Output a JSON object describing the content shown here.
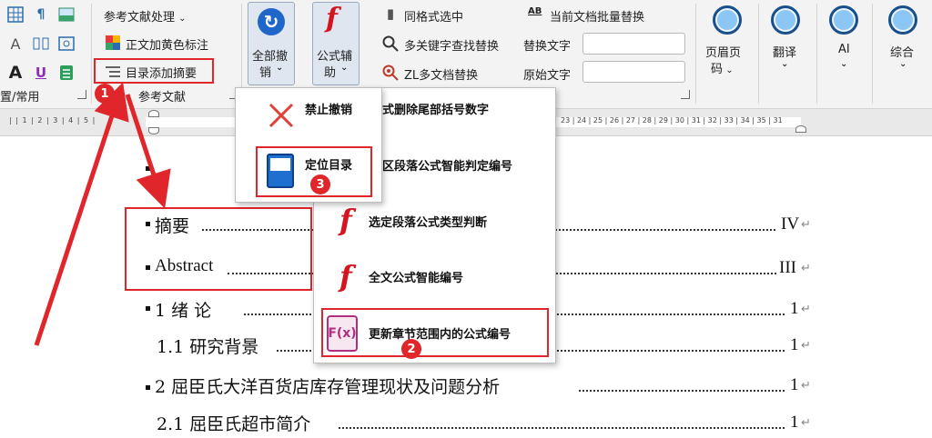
{
  "ribbon": {
    "left_group_label": "置/常用",
    "ref_processing": "参考文献处理",
    "yellow_mark": "正文加黄色标注",
    "toc_add_abstract": "目录添加摘要",
    "group_reference": "参考文献",
    "undo_all_line1": "全部撤",
    "undo_all_line2": "销",
    "formula_line1": "公式辅",
    "formula_line2": "助",
    "same_format": "同格式选中",
    "batch_replace": "当前文档批量替换",
    "multi_keyword": "多关键字查找替换",
    "replace_label": "替换文字",
    "multi_doc": "ZL多文档替换",
    "original_label": "原始文字",
    "header_footer_line1": "页眉页",
    "header_footer_line2": "码",
    "translate": "翻译",
    "ai": "AI",
    "combined": "综合"
  },
  "undo_menu": {
    "forbid_undo": "禁止撤销",
    "locate_toc": "定位目录"
  },
  "formula_menu": {
    "item1": "式删除尾部括号数字",
    "item2": "区段落公式智能判定编号",
    "item3": "选定段落公式类型判断",
    "item4": "全文公式智能编号",
    "item5": "更新章节范围内的公式编号"
  },
  "ruler": {
    "left": "| | 1 | 2 | 3 | 4 | 5 |",
    "right": "23 | 24 | 25 | 26 | 27 | 28 | 29 | 30 | 31 | 32 | 33 | 34 | 35 | 31"
  },
  "toc": [
    {
      "text": "摘要",
      "page": "IV"
    },
    {
      "text": "Abstract",
      "page": "III"
    },
    {
      "text": "1 绪  论",
      "page": "1"
    },
    {
      "text": "1.1 研究背景",
      "page": "1"
    },
    {
      "text": "2 屈臣氏大洋百货店库存管理现状及问题分析",
      "page": "1"
    },
    {
      "text": "2.1 屈臣氏超市简介",
      "page": "1"
    }
  ],
  "badges": [
    "1",
    "2",
    "3"
  ],
  "colors": {
    "accent_red": "#e0252b",
    "formula_red": "#d4141e",
    "ai_circle": "#8cc6f4"
  }
}
